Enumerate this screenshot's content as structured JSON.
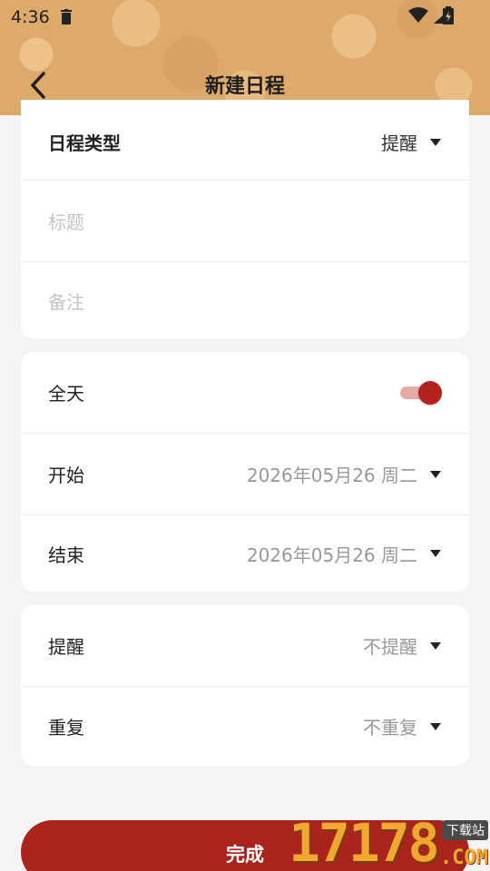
{
  "status_bar": {
    "time": "4:36"
  },
  "header": {
    "title": "新建日程"
  },
  "card_basic": {
    "type_label": "日程类型",
    "type_value": "提醒",
    "title_placeholder": "标题",
    "note_placeholder": "备注"
  },
  "card_time": {
    "all_day_label": "全天",
    "all_day_on": true,
    "start_label": "开始",
    "start_value": "2026年05月26 周二",
    "end_label": "结束",
    "end_value": "2026年05月26 周二"
  },
  "card_options": {
    "reminder_label": "提醒",
    "reminder_value": "不提醒",
    "repeat_label": "重复",
    "repeat_value": "不重复"
  },
  "done_button": {
    "label": "完成"
  },
  "watermark": {
    "digits": "17178",
    "suffix": ".COM",
    "badge": "下载站"
  },
  "colors": {
    "header_bg": "#deaa6b",
    "accent": "#b5221d",
    "button": "#a8241d"
  }
}
